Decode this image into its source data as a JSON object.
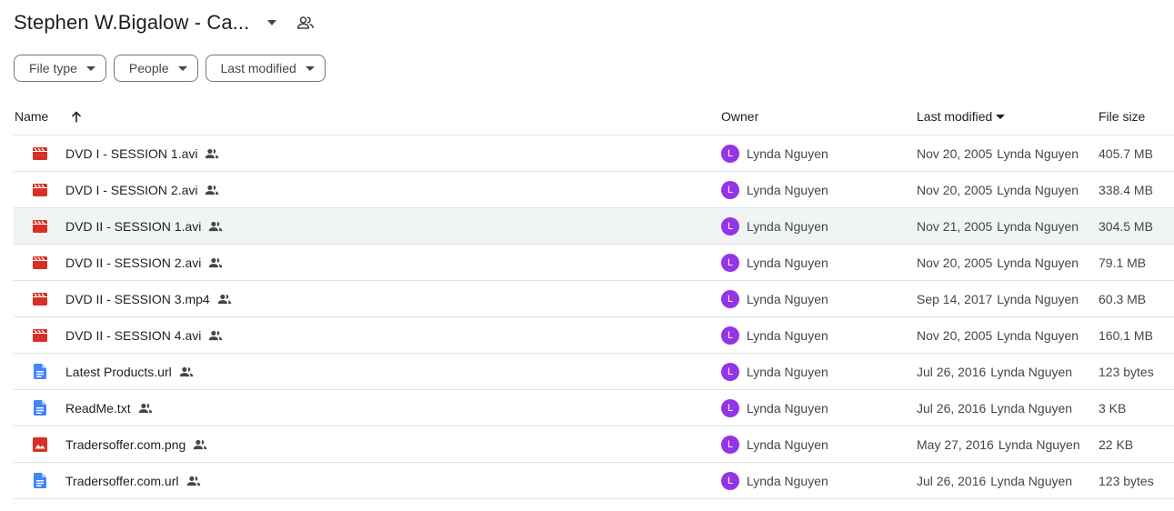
{
  "header": {
    "folder_title": "Stephen W.Bigalow - Ca...",
    "caret_icon": "arrow-drop-down-icon",
    "shared_icon": "people-icon"
  },
  "filters": [
    {
      "label": "File type"
    },
    {
      "label": "People"
    },
    {
      "label": "Last modified"
    }
  ],
  "table": {
    "columns": {
      "name": "Name",
      "owner": "Owner",
      "last_modified": "Last modified",
      "file_size": "File size"
    },
    "sort": {
      "column": "name",
      "direction": "ascending"
    },
    "rows": [
      {
        "name": "DVD I - SESSION 1.avi",
        "type": "video",
        "owner_initial": "L",
        "owner": "Lynda Nguyen",
        "date": "Nov 20, 2005",
        "modified_by": "Lynda Nguyen",
        "size": "405.7 MB"
      },
      {
        "name": "DVD I - SESSION 2.avi",
        "type": "video",
        "owner_initial": "L",
        "owner": "Lynda Nguyen",
        "date": "Nov 20, 2005",
        "modified_by": "Lynda Nguyen",
        "size": "338.4 MB"
      },
      {
        "name": "DVD II - SESSION 1.avi",
        "type": "video",
        "owner_initial": "L",
        "owner": "Lynda Nguyen",
        "date": "Nov 21, 2005",
        "modified_by": "Lynda Nguyen",
        "size": "304.5 MB"
      },
      {
        "name": "DVD II - SESSION 2.avi",
        "type": "video",
        "owner_initial": "L",
        "owner": "Lynda Nguyen",
        "date": "Nov 20, 2005",
        "modified_by": "Lynda Nguyen",
        "size": "79.1 MB"
      },
      {
        "name": "DVD II - SESSION 3.mp4",
        "type": "video",
        "owner_initial": "L",
        "owner": "Lynda Nguyen",
        "date": "Sep 14, 2017",
        "modified_by": "Lynda Nguyen",
        "size": "60.3 MB"
      },
      {
        "name": "DVD II - SESSION 4.avi",
        "type": "video",
        "owner_initial": "L",
        "owner": "Lynda Nguyen",
        "date": "Nov 20, 2005",
        "modified_by": "Lynda Nguyen",
        "size": "160.1 MB"
      },
      {
        "name": "Latest Products.url",
        "type": "document",
        "owner_initial": "L",
        "owner": "Lynda Nguyen",
        "date": "Jul 26, 2016",
        "modified_by": "Lynda Nguyen",
        "size": "123 bytes"
      },
      {
        "name": "ReadMe.txt",
        "type": "document",
        "owner_initial": "L",
        "owner": "Lynda Nguyen",
        "date": "Jul 26, 2016",
        "modified_by": "Lynda Nguyen",
        "size": "3 KB"
      },
      {
        "name": "Tradersoffer.com.png",
        "type": "image",
        "owner_initial": "L",
        "owner": "Lynda Nguyen",
        "date": "May 27, 2016",
        "modified_by": "Lynda Nguyen",
        "size": "22 KB"
      },
      {
        "name": "Tradersoffer.com.url",
        "type": "document",
        "owner_initial": "L",
        "owner": "Lynda Nguyen",
        "date": "Jul 26, 2016",
        "modified_by": "Lynda Nguyen",
        "size": "123 bytes"
      }
    ],
    "selected_row": 2
  },
  "colors": {
    "video_icon": "#d93025",
    "image_icon": "#d93025",
    "document_icon": "#4285f4",
    "avatar": "#9334e6",
    "selected_row_bg": "#f0f4f4"
  }
}
